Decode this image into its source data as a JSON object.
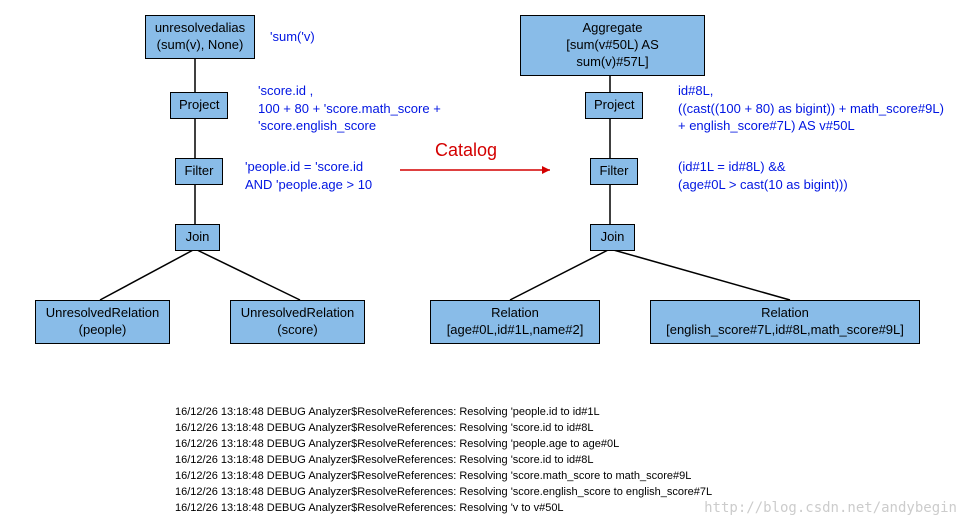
{
  "left_tree": {
    "n0": "unresolvedalias\n(sum(v), None)",
    "n1": "Project",
    "n2": "Filter",
    "n3": "Join",
    "n4": "UnresolvedRelation\n(people)",
    "n5": "UnresolvedRelation\n(score)",
    "a0": "'sum('v)",
    "a1": "'score.id ,\n100 + 80 + 'score.math_score +\n'score.english_score",
    "a2": "'people.id = 'score.id\nAND 'people.age > 10"
  },
  "right_tree": {
    "n0": "Aggregate\n[sum(v#50L) AS sum(v)#57L]",
    "n1": "Project",
    "n2": "Filter",
    "n3": "Join",
    "n4": "Relation\n[age#0L,id#1L,name#2]",
    "n5": "Relation\n[english_score#7L,id#8L,math_score#9L]",
    "a1": "id#8L,\n((cast((100 + 80) as bigint)) + math_score#9L)\n + english_score#7L) AS v#50L",
    "a2": "(id#1L = id#8L) &&\n(age#0L > cast(10 as bigint)))"
  },
  "catalog_label": "Catalog",
  "logs": [
    "16/12/26 13:18:48 DEBUG Analyzer$ResolveReferences: Resolving 'people.id to id#1L",
    "16/12/26 13:18:48 DEBUG Analyzer$ResolveReferences: Resolving 'score.id to id#8L",
    "16/12/26 13:18:48 DEBUG Analyzer$ResolveReferences: Resolving 'people.age to age#0L",
    "16/12/26 13:18:48 DEBUG Analyzer$ResolveReferences: Resolving 'score.id to id#8L",
    "16/12/26 13:18:48 DEBUG Analyzer$ResolveReferences: Resolving 'score.math_score to math_score#9L",
    "16/12/26 13:18:48 DEBUG Analyzer$ResolveReferences: Resolving 'score.english_score to english_score#7L",
    "16/12/26 13:18:48 DEBUG Analyzer$ResolveReferences: Resolving 'v to v#50L"
  ],
  "watermark": "http://blog.csdn.net/andybegin"
}
